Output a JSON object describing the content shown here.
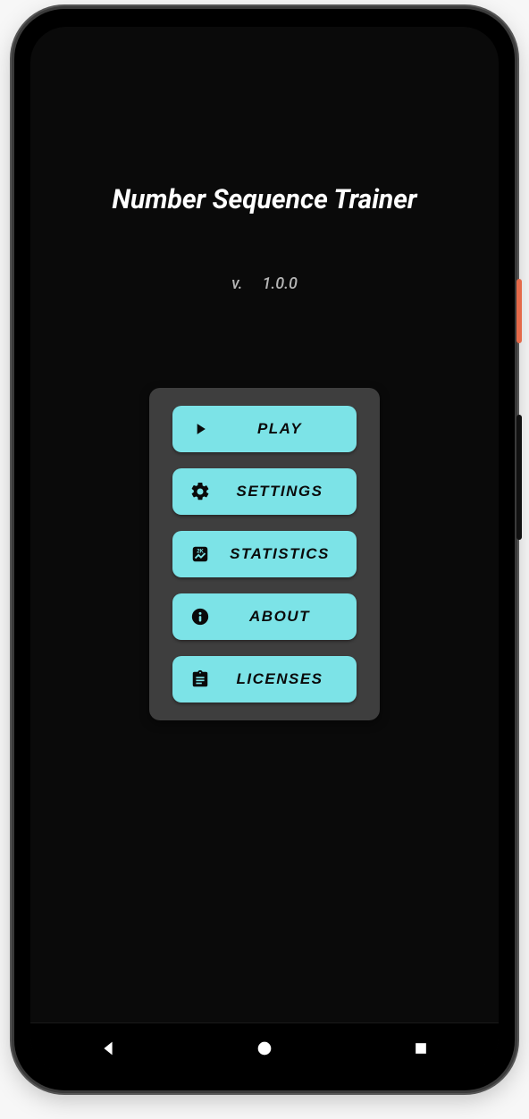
{
  "app": {
    "title": "Number Sequence Trainer",
    "version_prefix": "v.",
    "version": "1.0.0"
  },
  "menu": {
    "play": "PLAY",
    "settings": "SETTINGS",
    "statistics": "STATISTICS",
    "about": "ABOUT",
    "licenses": "LICENSES"
  },
  "colors": {
    "button": "#7ce3e7",
    "panel": "#3e3e3e",
    "bg": "#0a0a0a"
  }
}
